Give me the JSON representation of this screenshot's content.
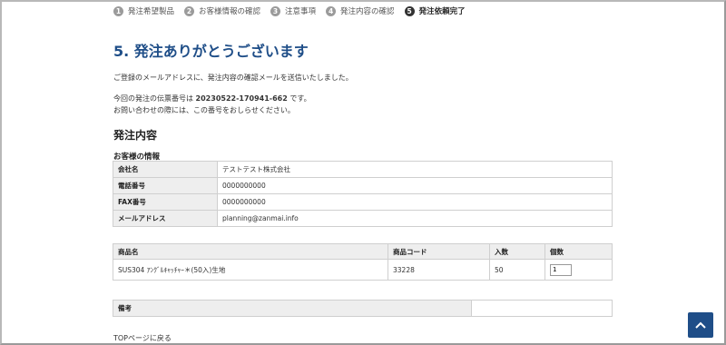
{
  "steps": [
    {
      "num": "1",
      "label": "発注希望製品"
    },
    {
      "num": "2",
      "label": "お客様情報の確認"
    },
    {
      "num": "3",
      "label": "注意事項"
    },
    {
      "num": "4",
      "label": "発注内容の確認"
    },
    {
      "num": "5",
      "label": "発注依頼完了"
    }
  ],
  "title": "5. 発注ありがとうございます",
  "message": {
    "line1": "ご登録のメールアドレスに、発注内容の確認メールを送信いたしました。",
    "order_prefix": "今回の発注の伝票番号は ",
    "order_number": "20230522-170941-662",
    "order_suffix": " です。",
    "line3": "お問い合わせの際には、この番号をおしらせください。"
  },
  "section_title": "発注内容",
  "customer": {
    "heading": "お客様の情報",
    "rows": [
      {
        "key": "会社名",
        "value": "テストテスト株式会社"
      },
      {
        "key": "電話番号",
        "value": "0000000000"
      },
      {
        "key": "FAX番号",
        "value": "0000000000"
      },
      {
        "key": "メールアドレス",
        "value": "planning@zanmai.info"
      }
    ]
  },
  "products": {
    "headers": {
      "name": "商品名",
      "code": "商品コード",
      "qty": "入数",
      "count": "個数"
    },
    "rows": [
      {
        "name": "SUS304 ｱﾝｸﾞﾙｷｬｯﾁｬｰ＊(50入)生地",
        "code": "33228",
        "qty": "50",
        "count": "1"
      }
    ]
  },
  "note": {
    "key": "備考",
    "value": ""
  },
  "top_link": "TOPページに戻る",
  "colors": {
    "accent": "#1f4e88",
    "step_inactive": "#9b9b9b",
    "step_active": "#333333",
    "table_header": "#eeeeee"
  },
  "icons": {
    "scroll_top": "chevron-up-icon"
  }
}
